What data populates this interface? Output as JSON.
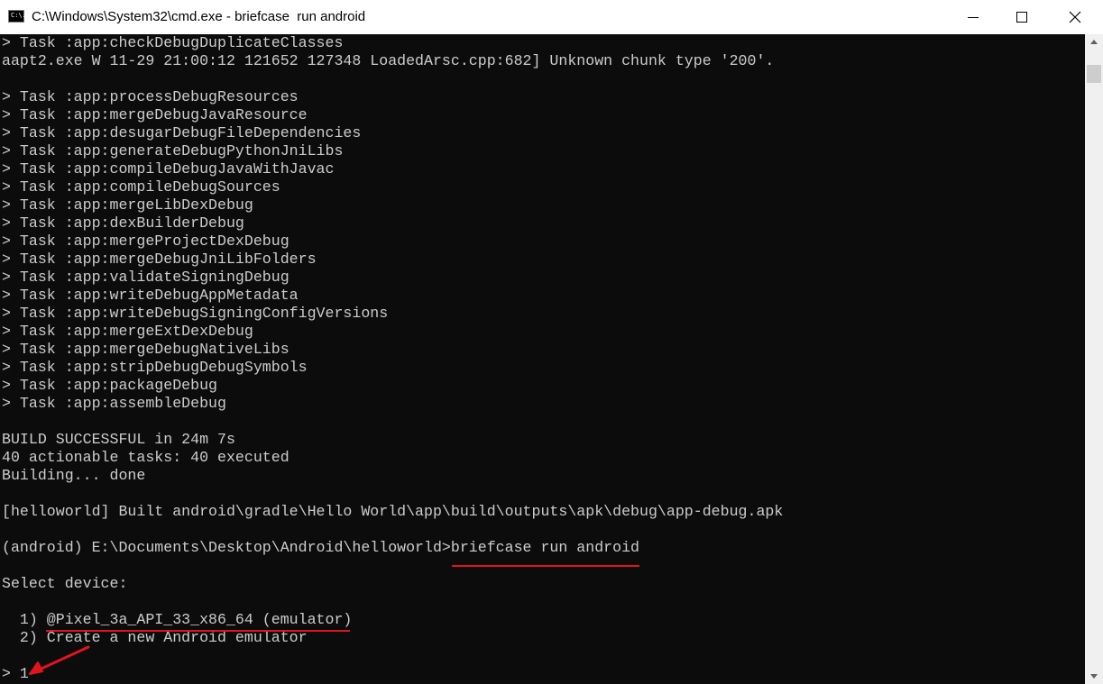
{
  "window": {
    "title": "C:\\Windows\\System32\\cmd.exe - briefcase  run android",
    "icon": "console-app-icon",
    "icon_text": "C:\\."
  },
  "controls": {
    "minimize": "minimize-icon",
    "maximize": "maximize-icon",
    "close": "close-icon"
  },
  "console": {
    "lines": [
      "> Task :app:checkDebugDuplicateClasses",
      "aapt2.exe W 11-29 21:00:12 121652 127348 LoadedArsc.cpp:682] Unknown chunk type '200'.",
      "",
      "> Task :app:processDebugResources",
      "> Task :app:mergeDebugJavaResource",
      "> Task :app:desugarDebugFileDependencies",
      "> Task :app:generateDebugPythonJniLibs",
      "> Task :app:compileDebugJavaWithJavac",
      "> Task :app:compileDebugSources",
      "> Task :app:mergeLibDexDebug",
      "> Task :app:dexBuilderDebug",
      "> Task :app:mergeProjectDexDebug",
      "> Task :app:mergeDebugJniLibFolders",
      "> Task :app:validateSigningDebug",
      "> Task :app:writeDebugAppMetadata",
      "> Task :app:writeDebugSigningConfigVersions",
      "> Task :app:mergeExtDexDebug",
      "> Task :app:mergeDebugNativeLibs",
      "> Task :app:stripDebugDebugSymbols",
      "> Task :app:packageDebug",
      "> Task :app:assembleDebug",
      "",
      "BUILD SUCCESSFUL in 24m 7s",
      "40 actionable tasks: 40 executed",
      "Building... done",
      "",
      "[helloworld] Built android\\gradle\\Hello World\\app\\build\\outputs\\apk\\debug\\app-debug.apk",
      "",
      "(android) E:\\Documents\\Desktop\\Android\\helloworld>briefcase run android",
      "",
      "Select device:",
      "",
      "  1) @Pixel_3a_API_33_x86_64 (emulator)",
      "  2) Create a new Android emulator",
      "",
      "> 1"
    ]
  },
  "annotations": {
    "underline_color": "#e0141e",
    "arrow_color": "#e0141e"
  }
}
